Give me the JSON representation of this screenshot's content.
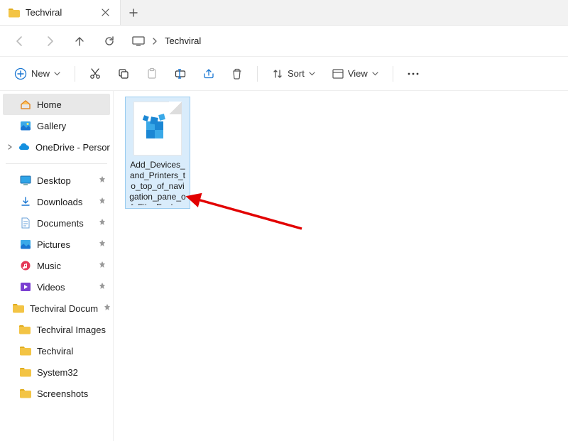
{
  "tab": {
    "title": "Techviral"
  },
  "breadcrumb": {
    "current": "Techviral"
  },
  "toolbar": {
    "new_label": "New",
    "sort_label": "Sort",
    "view_label": "View"
  },
  "sidebar": {
    "home": "Home",
    "gallery": "Gallery",
    "onedrive": "OneDrive - Persona",
    "quick": [
      {
        "label": "Desktop",
        "type": "desktop",
        "pinned": true
      },
      {
        "label": "Downloads",
        "type": "downloads",
        "pinned": true
      },
      {
        "label": "Documents",
        "type": "documents",
        "pinned": true
      },
      {
        "label": "Pictures",
        "type": "pictures",
        "pinned": true
      },
      {
        "label": "Music",
        "type": "music",
        "pinned": true
      },
      {
        "label": "Videos",
        "type": "videos",
        "pinned": true
      },
      {
        "label": "Techviral Docum",
        "type": "folder",
        "pinned": true
      },
      {
        "label": "Techviral Images",
        "type": "folder",
        "pinned": false
      },
      {
        "label": "Techviral",
        "type": "folder",
        "pinned": false
      },
      {
        "label": "System32",
        "type": "folder",
        "pinned": false
      },
      {
        "label": "Screenshots",
        "type": "folder",
        "pinned": false
      }
    ]
  },
  "file": {
    "name": "Add_Devices_and_Printers_to_top_of_navigation_pane_of_File_Explo..."
  }
}
